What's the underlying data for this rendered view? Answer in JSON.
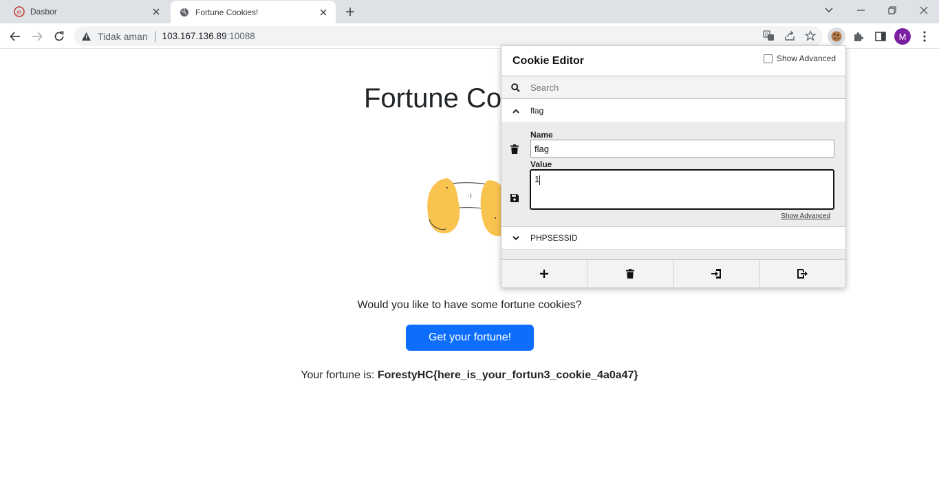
{
  "browser": {
    "tabs": [
      {
        "title": "Dasbor",
        "active": false
      },
      {
        "title": "Fortune Cookies!",
        "active": true
      }
    ],
    "security_label": "Tidak aman",
    "url_host": "103.167.136.89",
    "url_port": ":10088",
    "profile_initial": "M"
  },
  "page": {
    "heading": "Fortune Co",
    "question": "Would you like to have some fortune cookies?",
    "button_label": "Get your fortune!",
    "result_prefix": "Your fortune is: ",
    "result_value": "ForestyHC{here_is_your_fortun3_cookie_4a0a47}",
    "illustration_text": ":)"
  },
  "cookie_editor": {
    "title": "Cookie Editor",
    "show_advanced_label": "Show Advanced",
    "search_placeholder": "Search",
    "cookies": [
      {
        "name": "flag",
        "expanded": true
      },
      {
        "name": "PHPSESSID",
        "expanded": false
      }
    ],
    "name_label": "Name",
    "name_value": "flag",
    "value_label": "Value",
    "value_value": "1",
    "show_advanced_link": "Show Advanced"
  }
}
